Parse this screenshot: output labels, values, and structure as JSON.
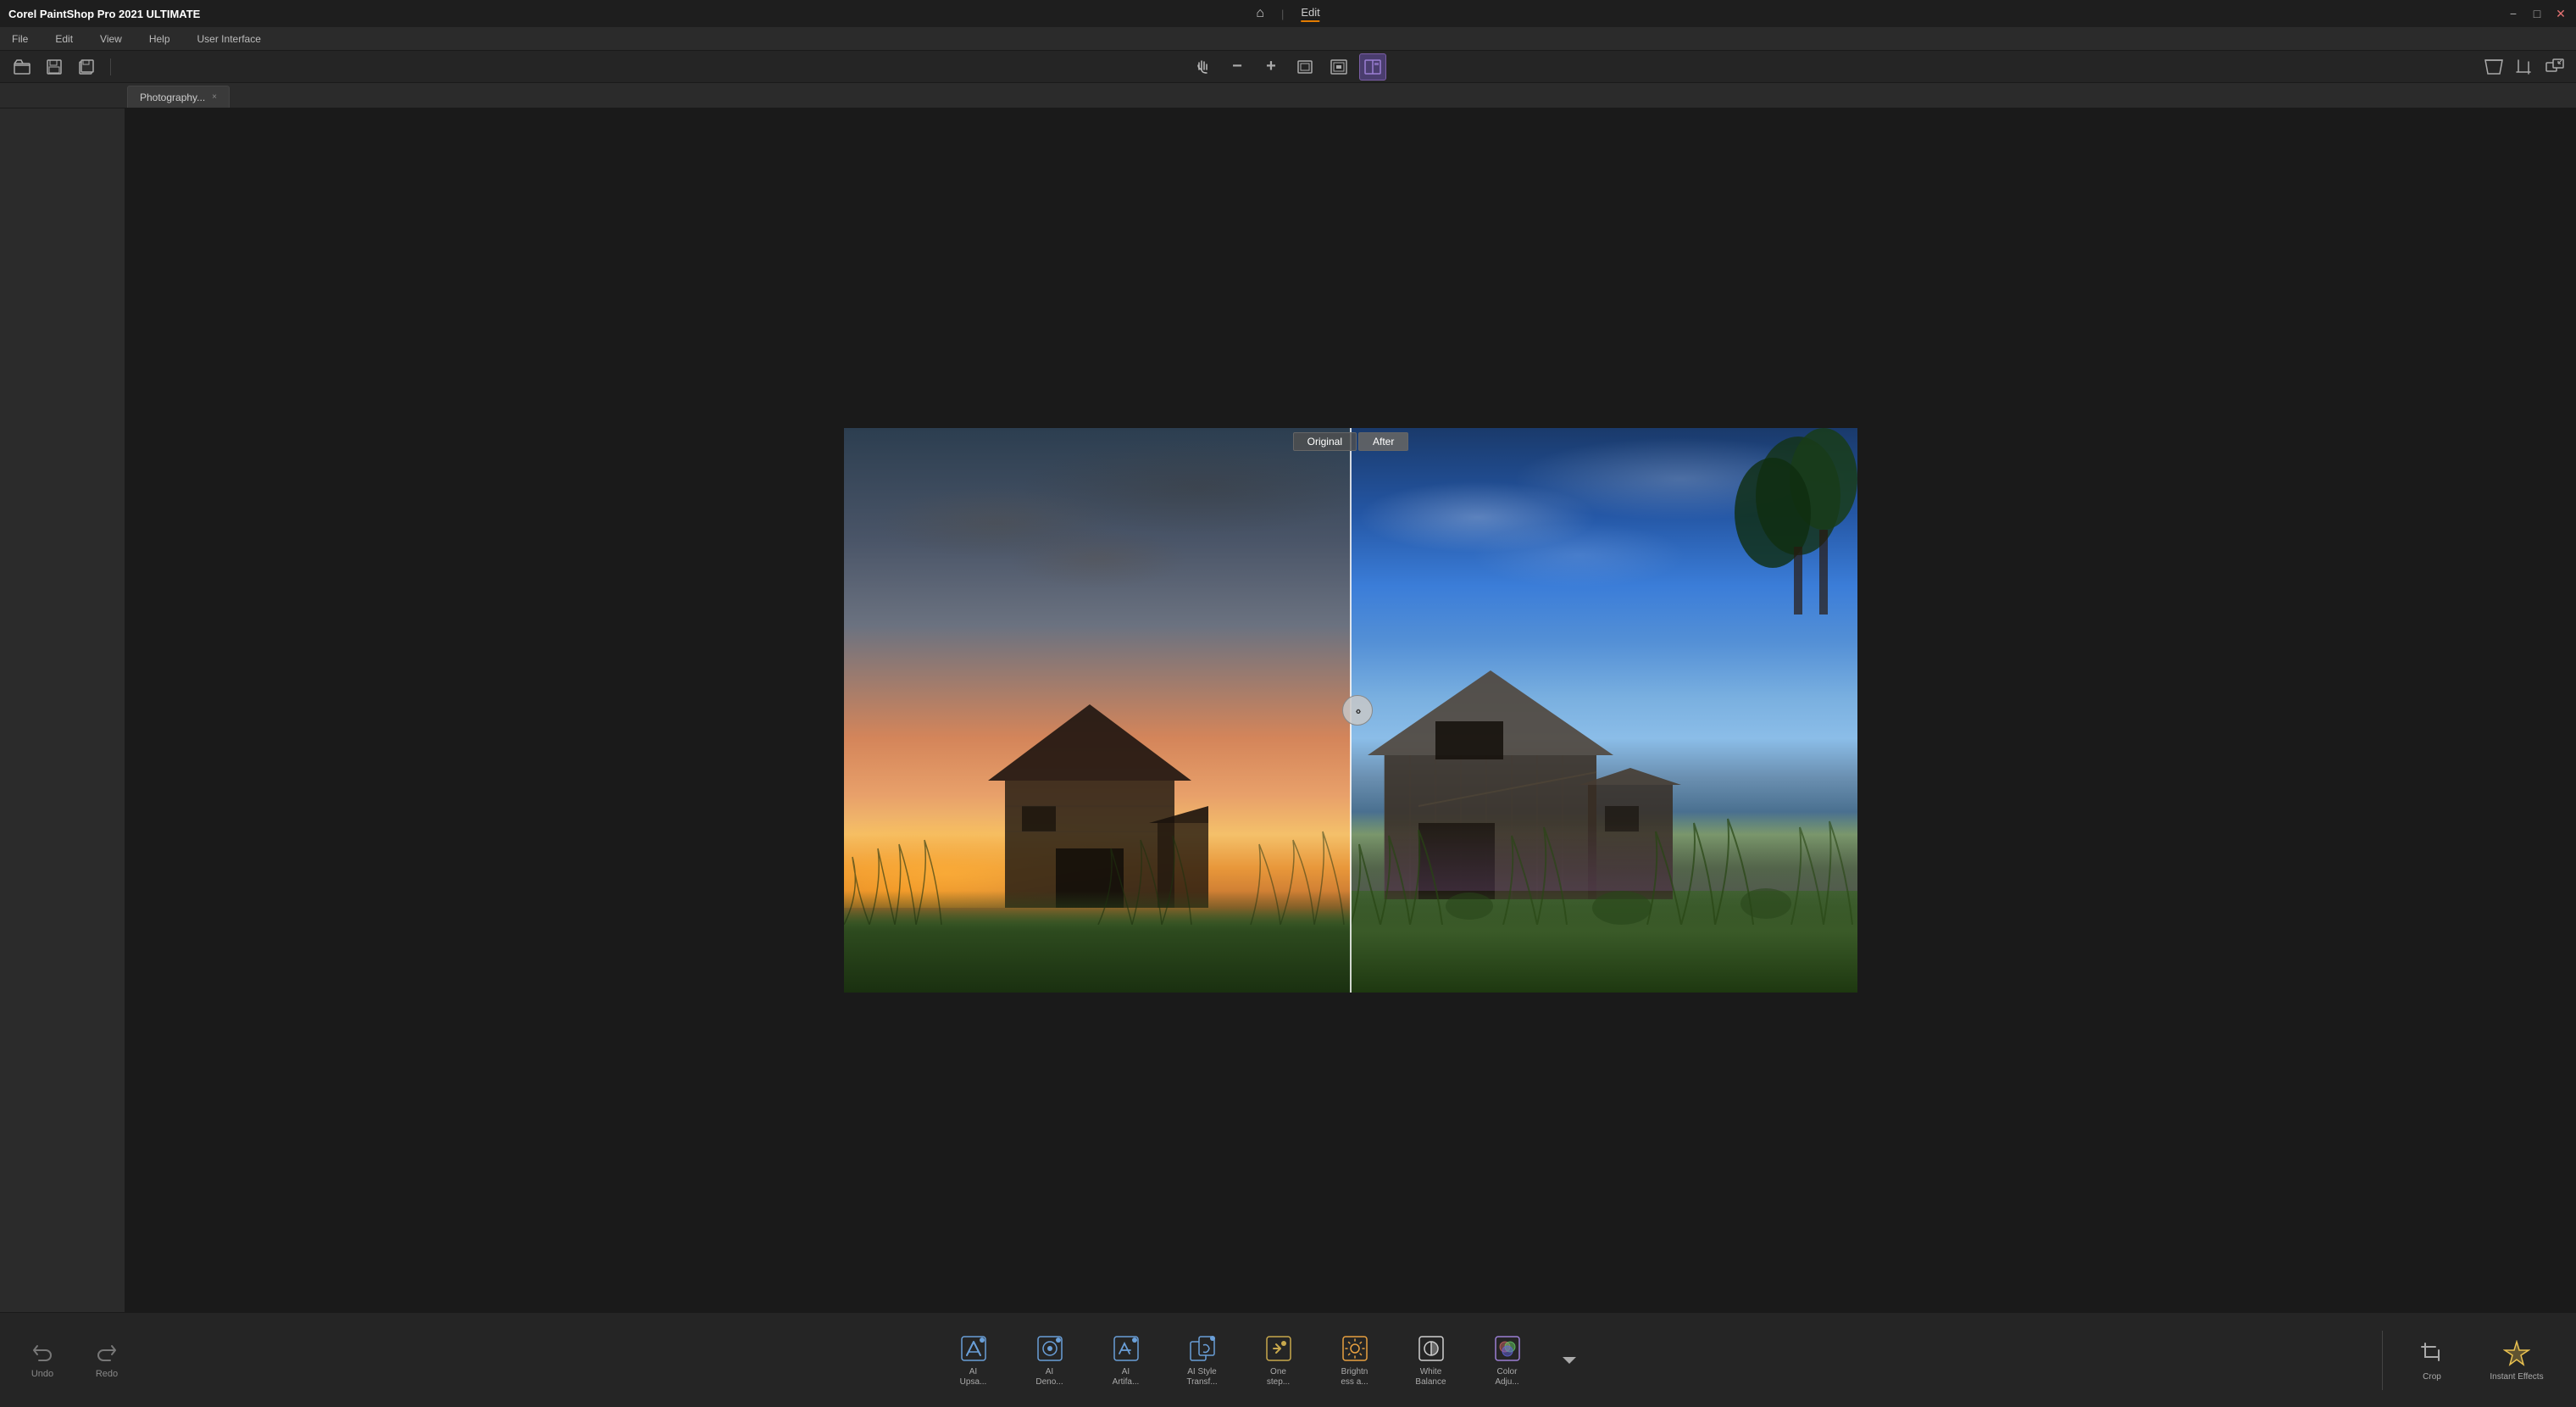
{
  "app": {
    "title": "Corel PaintShop Pro 2021 ULTIMATE",
    "brand": "Corel",
    "product": "PaintShop Pro",
    "version": "2021",
    "edition": "ULTIMATE"
  },
  "titlebar": {
    "home_icon": "⌂",
    "divider": "|",
    "edit_label": "Edit",
    "minimize": "−",
    "restore": "□",
    "close": "✕"
  },
  "menu": {
    "items": [
      "File",
      "Edit",
      "View",
      "Help",
      "User Interface"
    ]
  },
  "toolbar": {
    "open_icon": "📂",
    "save_icon": "💾",
    "saveall_icon": "📋"
  },
  "tab": {
    "label": "Photography...",
    "close": "×"
  },
  "view": {
    "original_label": "Original",
    "after_label": "After"
  },
  "center_tools": {
    "pan_icon": "✋",
    "zoom_out_icon": "−",
    "zoom_in_icon": "+",
    "fit_icon": "⊞",
    "actual_icon": "⊡",
    "split_icon": "▐"
  },
  "top_right_tools": {
    "perspective_icon": "◪",
    "crop_icon": "⌐",
    "resize_icon": "⤢"
  },
  "bottom_tools": {
    "undo_icon": "↺",
    "undo_label": "Undo",
    "redo_icon": "↻",
    "redo_label": "Redo",
    "tools": [
      {
        "id": "ai-upscale",
        "label": "AI\nUpsa...",
        "icon": "✦"
      },
      {
        "id": "ai-denoise",
        "label": "AI\nDeno...",
        "icon": "✦"
      },
      {
        "id": "ai-artifact",
        "label": "AI\nArtifa...",
        "icon": "✦"
      },
      {
        "id": "ai-style",
        "label": "AI Style\nTransf...",
        "icon": "✦"
      },
      {
        "id": "one-step",
        "label": "One\nstep...",
        "icon": "⚡"
      },
      {
        "id": "brightness",
        "label": "Brightn\ness a...",
        "icon": "☀"
      },
      {
        "id": "white-balance",
        "label": "White\nBalance",
        "icon": "◑"
      },
      {
        "id": "color-adjust",
        "label": "Color\nAdju...",
        "icon": "◈"
      }
    ],
    "more_icon": "▾",
    "crop_label": "Crop",
    "crop_icon": "⊡",
    "instant_effects_label": "Instant Effects",
    "instant_effects_icon": "✦"
  },
  "colors": {
    "bg_dark": "#1e1e1e",
    "bg_mid": "#252525",
    "bg_light": "#2b2b2b",
    "accent": "#e37c00",
    "active_tool": "#4a3d6e",
    "border": "#444444"
  }
}
